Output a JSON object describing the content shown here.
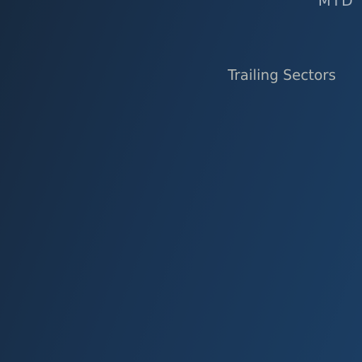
{
  "header": {
    "period_label": "MTD"
  },
  "section": {
    "title": "Trailing Sectors"
  },
  "colors": {
    "background_start": "#172a40",
    "background_end": "#1b3d62",
    "text_muted": "#b3b7b3"
  }
}
